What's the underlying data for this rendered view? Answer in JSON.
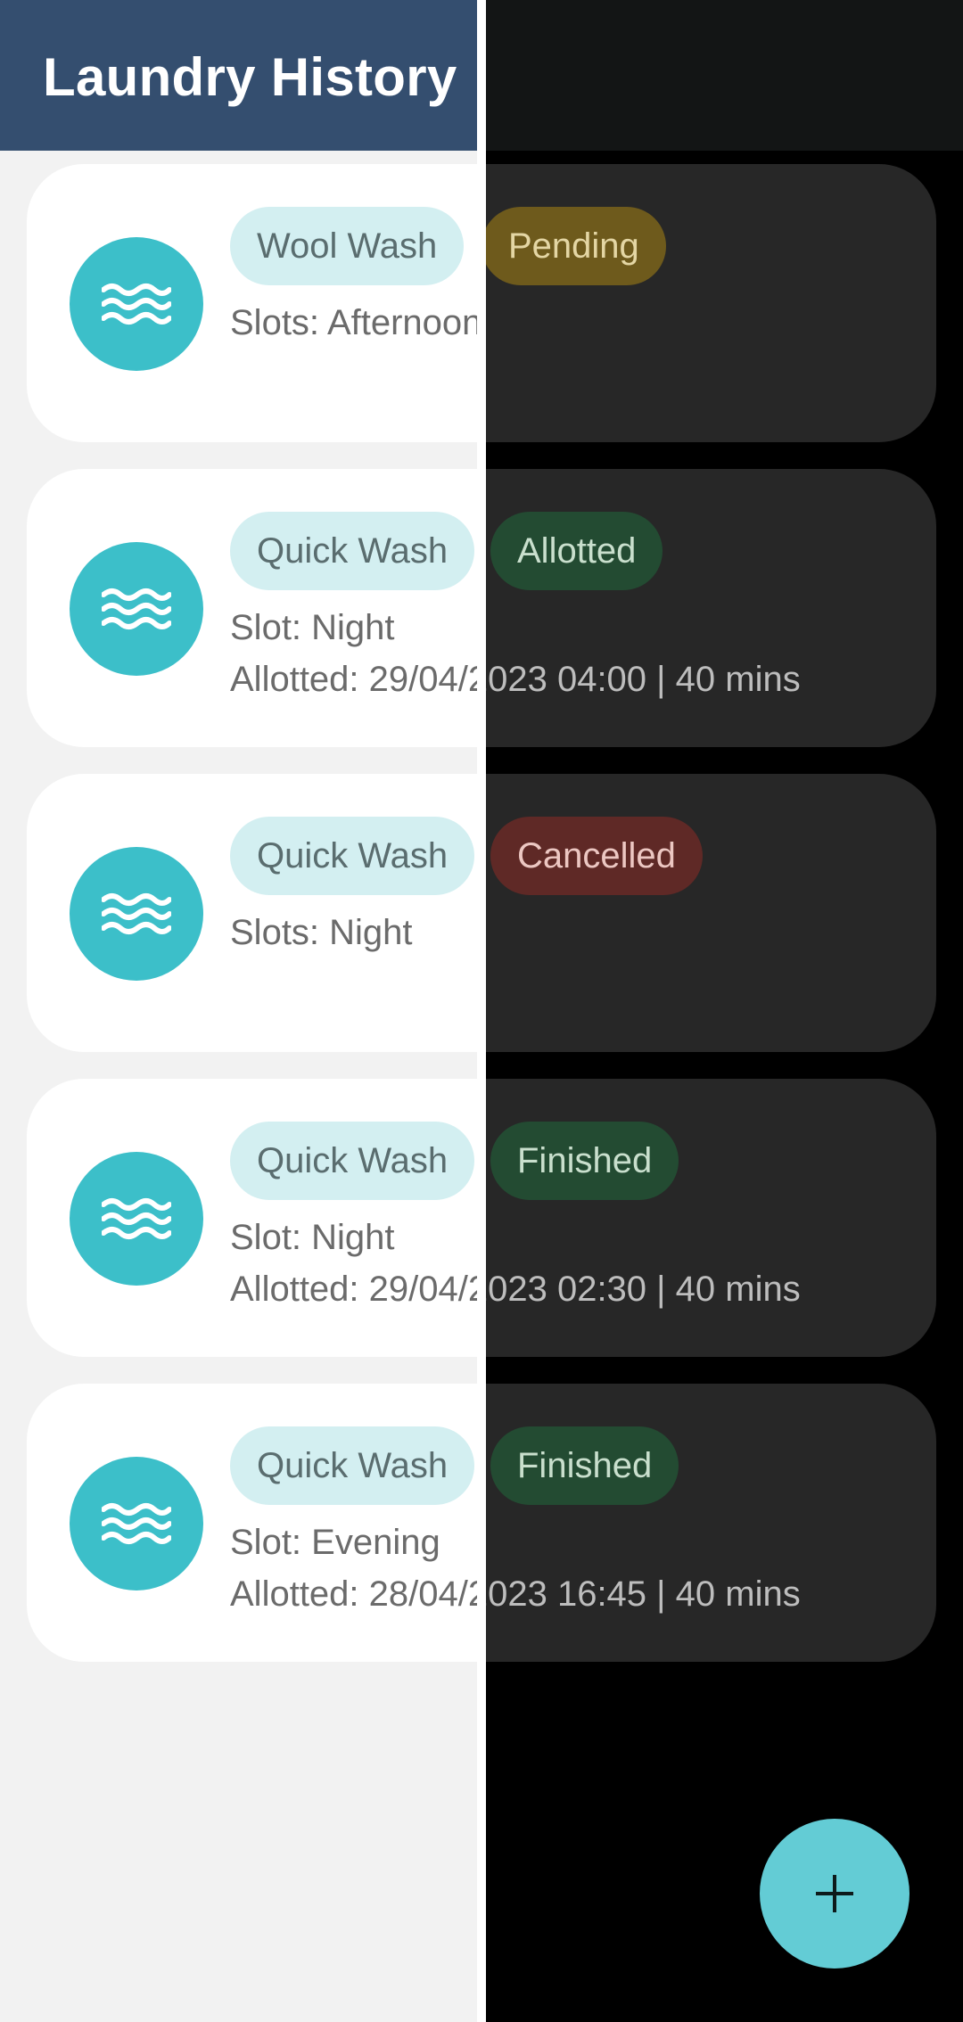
{
  "app": {
    "title": "Laundry History"
  },
  "items": [
    {
      "type": "Wool Wash",
      "status": "Pending",
      "status_key": "pending",
      "line1": "Slots: Afternoon",
      "line2": ""
    },
    {
      "type": "Quick Wash",
      "status": "Allotted",
      "status_key": "allotted",
      "line1": "Slot: Night",
      "line2": "Allotted: 29/04/2023 04:00 | 40 mins"
    },
    {
      "type": "Quick Wash",
      "status": "Cancelled",
      "status_key": "cancelled",
      "line1": "Slots: Night",
      "line2": ""
    },
    {
      "type": "Quick Wash",
      "status": "Finished",
      "status_key": "finished",
      "line1": "Slot: Night",
      "line2": "Allotted: 29/04/2023 02:30 | 40 mins"
    },
    {
      "type": "Quick Wash",
      "status": "Finished",
      "status_key": "finished",
      "line1": "Slot: Evening",
      "line2": "Allotted: 28/04/2023 16:45 | 40 mins"
    }
  ],
  "icons": {
    "item_icon": "waves-icon",
    "fab_icon": "plus-icon"
  },
  "colors": {
    "appbar": "#344e6f",
    "accent": "#3cbfc9",
    "fab": "#63ccd5",
    "pending": "#6e5a1c",
    "finished": "#234b32",
    "cancelled": "#5f2926"
  }
}
